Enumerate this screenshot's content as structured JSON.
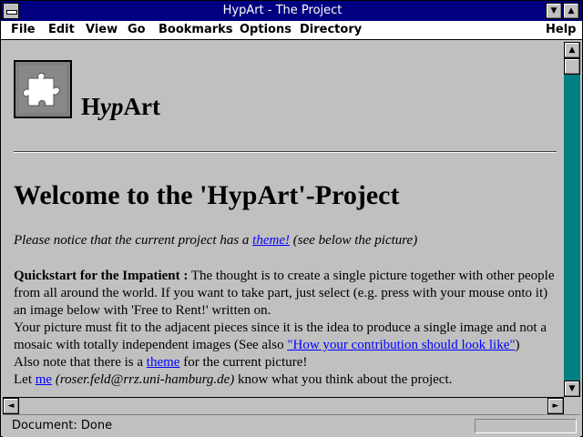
{
  "window": {
    "title": "HypArt - The Project"
  },
  "menu": [
    "File",
    "Edit",
    "View",
    "Go",
    "Bookmarks",
    "Options",
    "Directory",
    "Help"
  ],
  "page": {
    "brand_prefix": "H",
    "brand_italic": "yp",
    "brand_suffix": "Art",
    "heading": "Welcome to the 'HypArt'-Project",
    "notice_before": "Please notice that the current project has a ",
    "notice_link": "theme!",
    "notice_after": " (see below the picture)",
    "quick_label": "Quickstart for the Impatient :",
    "quick_text": " The thought is to create a single picture together with other people from all around the world. If you want to take part, just select (e.g. press with your mouse onto it) an image below with 'Free to Rent!' written on.",
    "fit_text": "Your picture must fit to the adjacent pieces since it is the idea to produce a single image and not a mosaic with totally independent images (See also ",
    "fit_link": "\"How your contribution should look like\"",
    "fit_after": ")",
    "also_before": "Also note that there is a ",
    "also_link": "theme",
    "also_after": " for the current picture!",
    "let_before": "Let ",
    "let_link": "me",
    "let_email": " (roser.feld@rrz.uni-hamburg.de)",
    "let_after": " know what you think about the project."
  },
  "status": {
    "text": "Document: Done"
  },
  "colors": {
    "titlebar": "#000080",
    "chrome": "#c0c0c0",
    "link": "#0000ff",
    "scroll_track": "#008080"
  }
}
